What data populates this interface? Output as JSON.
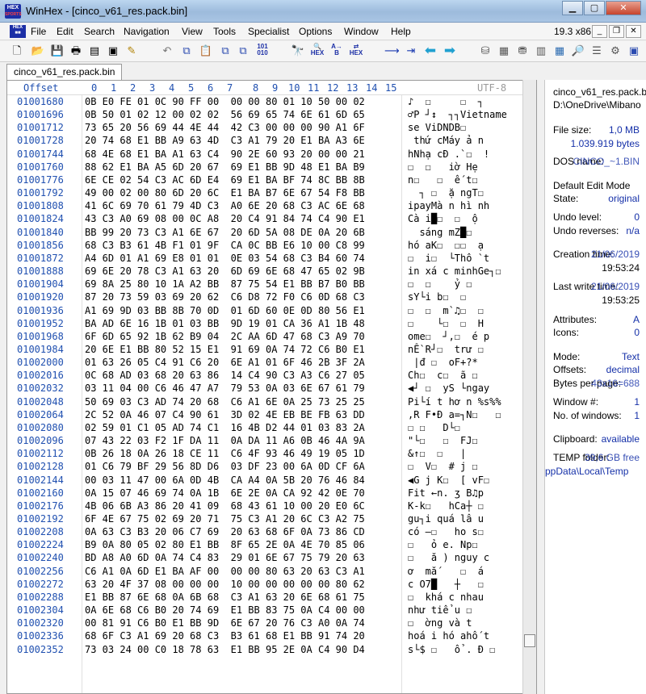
{
  "window": {
    "title": "WinHex - [cinco_v61_res.pack.bin]",
    "logo_top": "HEX",
    "logo_bottom": "SPORTS"
  },
  "menu": {
    "items": [
      {
        "label": "File"
      },
      {
        "label": "Edit"
      },
      {
        "label": "Search"
      },
      {
        "label": "Navigation"
      },
      {
        "label": "View"
      },
      {
        "label": "Tools"
      },
      {
        "label": "Specialist"
      },
      {
        "label": "Options"
      },
      {
        "label": "Window"
      },
      {
        "label": "Help"
      }
    ],
    "version": "19.3 x86"
  },
  "toolbar": {
    "icons": [
      "new-file-icon",
      "open-folder-icon",
      "save-icon",
      "print-icon",
      "properties-icon",
      "open-disk-icon",
      "undo-icon",
      "copy-icon",
      "paste-icon",
      "copy-block-icon",
      "paste-block-icon",
      "convert-icon",
      "find-text-icon",
      "find-hex-icon",
      "replace-text-icon",
      "replace-hex-icon",
      "go-to-offset-icon",
      "go-to-sector-icon",
      "back-icon",
      "forward-icon",
      "disk-editor-icon",
      "ram-editor-icon",
      "calculator-icon",
      "table-icon",
      "search-web-icon",
      "tools-icon",
      "help-icon"
    ]
  },
  "tab": {
    "label": "cinco_v61_res.pack.bin"
  },
  "hex_header": {
    "offset_label": "Offset",
    "columns": [
      "0",
      "1",
      "2",
      "3",
      "4",
      "5",
      "6",
      "7",
      "8",
      "9",
      "10",
      "11",
      "12",
      "13",
      "14",
      "15"
    ],
    "encoding": "UTF-8"
  },
  "rows": [
    {
      "offset": "01001680",
      "hex": "0B E0 FE 01 0C 90 FF 00  00 00 80 01 10 50 00 02",
      "text": "♪  ☐     ☐  ┐"
    },
    {
      "offset": "01001696",
      "hex": "0B 50 01 02 12 00 02 02  56 69 65 74 6E 61 6D 65",
      "text": "♂P ┘↕  ┐┐Vietname"
    },
    {
      "offset": "01001712",
      "hex": "73 65 20 56 69 44 4E 44  42 C3 00 00 00 90 A1 6F",
      "text": "se ViDNDB☐"
    },
    {
      "offset": "01001728",
      "hex": "20 74 68 E1 BB A9 63 4D  C3 A1 79 20 E1 BA A3 6E",
      "text": " thứ cMáy ả n"
    },
    {
      "offset": "01001744",
      "hex": "68 4E 68 E1 BA A1 63 C4  90 2E 60 93 20 00 00 21",
      "text": "hNhạ cĐ .`☐  !"
    },
    {
      "offset": "01001760",
      "hex": "88 62 E1 BA A5 6D 20 67  69 E1 BB 9D 48 E1 BA B9",
      "text": "☐  ☐   iờ Hẹ"
    },
    {
      "offset": "01001776",
      "hex": "6E CE 02 54 C3 AC 6D E4  69 E1 BA BF 74 8C BB 8B",
      "text": "n☐   ☐  ế t☐"
    },
    {
      "offset": "01001792",
      "hex": "49 00 02 00 80 6D 20 6C  E1 BA B7 6E 67 54 F8 BB",
      "text": "  ┐ ☐  ặ ngT☐"
    },
    {
      "offset": "01001808",
      "hex": "41 6C 69 70 61 79 4D C3  A0 6E 20 68 C3 AC 6E 68",
      "text": "ipayMà n hì nh"
    },
    {
      "offset": "01001824",
      "hex": "43 C3 A0 69 08 00 0C A8  20 C4 91 84 74 C4 90 E1",
      "text": "Cà i█☐  ☐  ộ"
    },
    {
      "offset": "01001840",
      "hex": "BB 99 20 73 C3 A1 6E 67  20 6D 5A 08 DE 0A 20 6B",
      "text": "  sáng mZ█☐"
    },
    {
      "offset": "01001856",
      "hex": "68 C3 B3 61 4B F1 01 9F  CA 0C BB E6 10 00 C8 99",
      "text": "hó aK☐  ☐☐  ạ"
    },
    {
      "offset": "01001872",
      "hex": "A4 6D 01 A1 69 E8 01 01  0E 03 54 68 C3 B4 60 74",
      "text": "☐  i☐  └Thô `t"
    },
    {
      "offset": "01001888",
      "hex": "69 6E 20 78 C3 A1 63 20  6D 69 6E 68 47 65 02 9B",
      "text": "in xá c minhGe┐☐"
    },
    {
      "offset": "01001904",
      "hex": "69 8A 25 80 10 1A A2 BB  87 75 54 E1 BB B7 B0 BB",
      "text": "☐  ☐    ỷ ☐"
    },
    {
      "offset": "01001920",
      "hex": "87 20 73 59 03 69 20 62  C6 D8 72 F0 C6 0D 68 C3",
      "text": "sY└i b☐  ☐"
    },
    {
      "offset": "01001936",
      "hex": "A1 69 9D 03 BB 8B 70 0D  01 6D 60 0E 0D 80 56 E1",
      "text": "☐  ☐  m`♫☐  ☐"
    },
    {
      "offset": "01001952",
      "hex": "BA AD 6E 16 1B 01 03 BB  9D 19 01 CA 36 A1 1B 48",
      "text": "☐    └☐  ☐  H"
    },
    {
      "offset": "01001968",
      "hex": "6F 6D 65 92 1B 62 B9 04  2C AA 6D 47 68 C3 A9 70",
      "text": "ome☐  ┘,☐  é p"
    },
    {
      "offset": "01001984",
      "hex": "20 6E E1 BB 80 52 15 E1  91 69 0A 74 72 C6 B0 E1",
      "text": "nỀ R┘☐  trư ☐"
    },
    {
      "offset": "01002000",
      "hex": "01 63 26 05 C4 91 C6 20  6E A1 01 6F 46 2B 3F 2A",
      "text": " |đ ☐  oF+?*"
    },
    {
      "offset": "01002016",
      "hex": "0C 68 AD 03 68 20 63 86  14 C4 90 C3 A3 C6 27 05",
      "text": "Ch☐  c☐  ã ☐"
    },
    {
      "offset": "01002032",
      "hex": "03 11 04 00 C6 46 47 A7  79 53 0A 03 6E 67 61 79",
      "text": "◀┘ ☐  yS └ngay"
    },
    {
      "offset": "01002048",
      "hex": "50 69 03 C3 AD 74 20 68  C6 A1 6E 0A 25 73 25 25",
      "text": "Pi└í t hơ n %s%%"
    },
    {
      "offset": "01002064",
      "hex": "2C 52 0A 46 07 C4 90 61  3D 02 4E EB BE FB 63 DD",
      "text": ",R F•Đ a=┐N☐   ☐"
    },
    {
      "offset": "01002080",
      "hex": "02 59 01 C1 05 AD 74 C1  16 4B D2 44 01 03 83 2A",
      "text": "☐ ☐   D└☐"
    },
    {
      "offset": "01002096",
      "hex": "07 43 22 03 F2 1F DA 11  0A DA 11 A6 0B 46 4A 9A",
      "text": "\"└☐   ☐  FJ☐"
    },
    {
      "offset": "01002112",
      "hex": "0B 26 18 0A 26 18 CE 11  C6 4F 93 46 49 19 05 1D",
      "text": "&↑☐  ☐   |"
    },
    {
      "offset": "01002128",
      "hex": "01 C6 79 BF 29 56 8D D6  03 DF 23 00 6A 0D CF 6A",
      "text": "☐  V☐  # j ☐"
    },
    {
      "offset": "01002144",
      "hex": "00 03 11 47 00 6A 0D 4B  CA A4 0A 5B 20 76 46 84",
      "text": "◀G j K☐  [ vF☐"
    },
    {
      "offset": "01002160",
      "hex": "0A 15 07 46 69 74 0A 1B  6E 2E 0A CA 92 42 0E 70",
      "text": "Fit ←n. ʒ B♫p"
    },
    {
      "offset": "01002176",
      "hex": "4B 06 6B A3 86 20 41 09  68 43 61 10 00 20 E0 6C",
      "text": "K-k☐   hCa┼ ☐"
    },
    {
      "offset": "01002192",
      "hex": "6F 4E 67 75 02 69 20 71  75 C3 A1 20 6C C3 A2 75",
      "text": "gu┐i quá lâ u"
    },
    {
      "offset": "01002208",
      "hex": "0A 63 C3 B3 20 06 C7 69  20 63 68 6F 0A 73 86 CD",
      "text": "có –☐   ho s☐"
    },
    {
      "offset": "01002224",
      "hex": "B9 0A 80 05 02 80 E1 BB  8F 65 2E 0A 4E 70 85 06",
      "text": "☐   ỏ e. Np☐"
    },
    {
      "offset": "01002240",
      "hex": "BD A8 A0 6D 0A 74 C4 83  29 01 6E 67 75 79 20 63",
      "text": "☐   ă ) nguy c"
    },
    {
      "offset": "01002256",
      "hex": "C6 A1 0A 6D E1 BA AF 00  00 00 80 63 20 63 C3 A1",
      "text": "ơ  mắ    ☐  á"
    },
    {
      "offset": "01002272",
      "hex": "63 20 4F 37 08 00 00 00  10 00 00 00 00 00 80 62",
      "text": "c O7█   ┼   ☐"
    },
    {
      "offset": "01002288",
      "hex": "E1 BB 87 6E 68 0A 6B 68  C3 A1 63 20 6E 68 61 75",
      "text": "☐  khá c nhau"
    },
    {
      "offset": "01002304",
      "hex": "0A 6E 68 C6 B0 20 74 69  E1 BB 83 75 0A C4 00 00",
      "text": "như tiể u ☐"
    },
    {
      "offset": "01002320",
      "hex": "00 81 91 C6 B0 E1 BB 9D  6E 67 20 76 C3 A0 0A 74",
      "text": "☐  ờng và t"
    },
    {
      "offset": "01002336",
      "hex": "68 6F C3 A1 69 20 68 C3  B3 61 68 E1 BB 91 74 20",
      "text": "hoá i hó ahố t"
    },
    {
      "offset": "01002352",
      "hex": "73 03 24 00 C0 18 78 63  E1 BB 95 2E 0A C4 90 D4",
      "text": "s└$ ☐   ổ . Đ ☐"
    }
  ],
  "info_panel": {
    "filename": "cinco_v61_res.pack.b",
    "path": "D:\\OneDrive\\Mibano",
    "file_size_label": "File size:",
    "file_size_value": "1,0 MB",
    "file_size_bytes": "1.039.919 bytes",
    "dos_name_label": "DOS name:",
    "dos_name_value": "CINCO_~1.BIN",
    "edit_mode_label": "Default Edit Mode",
    "state_label": "State:",
    "state_value": "original",
    "undo_level_label": "Undo level:",
    "undo_level_value": "0",
    "undo_reverses_label": "Undo reverses:",
    "undo_reverses_value": "n/a",
    "creation_label": "Creation time:",
    "creation_date": "21/06/2019",
    "creation_time": "19:53:24",
    "last_write_label": "Last write time:",
    "last_write_date": "21/06/2019",
    "last_write_time": "19:53:25",
    "attributes_label": "Attributes:",
    "attributes_value": "A",
    "icons_label": "Icons:",
    "icons_value": "0",
    "mode_label": "Mode:",
    "mode_value": "Text",
    "offsets_label": "Offsets:",
    "offsets_value": "decimal",
    "bpp_label": "Bytes per page:",
    "bpp_value": "43x16=688",
    "window_num_label": "Window #:",
    "window_num_value": "1",
    "num_windows_label": "No. of windows:",
    "num_windows_value": "1",
    "clipboard_label": "Clipboard:",
    "clipboard_value": "available",
    "temp_label": "TEMP folder:",
    "temp_value": "39,6 GB free",
    "temp_path": "ppData\\Local\\Temp"
  }
}
